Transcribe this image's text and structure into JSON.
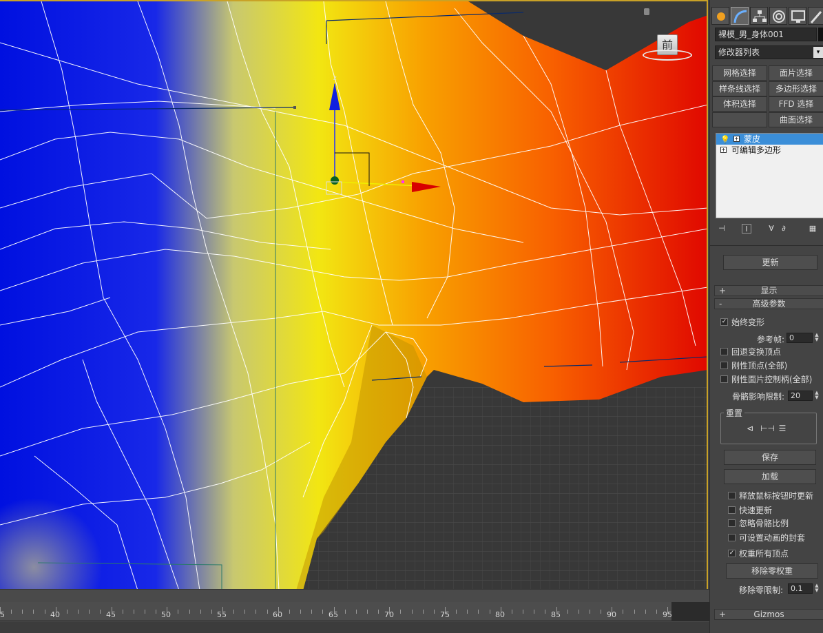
{
  "viewport": {
    "view_label": "前",
    "ruler_ticks": [
      "5",
      "40",
      "45",
      "50",
      "55",
      "60",
      "65",
      "70",
      "75",
      "80",
      "85",
      "90",
      "95"
    ]
  },
  "panel": {
    "object_name": "裸模_男_身体001",
    "modifier_list": "修改器列表",
    "preset_buttons": [
      "网格选择",
      "面片选择",
      "样条线选择",
      "多边形选择",
      "体积选择",
      "FFD 选择",
      "",
      "曲面选择"
    ],
    "stack": [
      {
        "label": "蒙皮",
        "selected": true
      },
      {
        "label": "可编辑多边形",
        "selected": false
      }
    ],
    "update_button": "更新",
    "rollout_display": "显示",
    "rollout_advanced": "高级参数",
    "always_deform": "始终变形",
    "ref_frame_label": "参考帧:",
    "ref_frame_value": "0",
    "checkboxes_a": [
      {
        "label": "回退变换顶点",
        "checked": false
      },
      {
        "label": "刚性顶点(全部)",
        "checked": false
      },
      {
        "label": "刚性面片控制柄(全部)",
        "checked": false
      }
    ],
    "bone_limit_label": "骨骼影响限制:",
    "bone_limit_value": "20",
    "reset_group": "重置",
    "save_button": "保存",
    "load_button": "加载",
    "checkboxes_b": [
      {
        "label": "释放鼠标按钮时更新",
        "checked": false
      },
      {
        "label": "快速更新",
        "checked": false
      },
      {
        "label": "忽略骨骼比例",
        "checked": false
      },
      {
        "label": "可设置动画的封套",
        "checked": false
      },
      {
        "label": "权重所有顶点",
        "checked": true
      }
    ],
    "remove_zero_weights": "移除零权重",
    "remove_zero_limit_label": "移除零限制:",
    "remove_zero_limit_value": "0.1",
    "rollout_gizmos": "Gizmos"
  },
  "colors": {
    "accent_border": "#c9a227",
    "selection_blue": "#3b8ed8",
    "weight_low": "#0010e0",
    "weight_mid": "#f0e010",
    "weight_high": "#e81000"
  },
  "icons": [
    "create-tab-icon",
    "modify-tab-icon",
    "hierarchy-tab-icon",
    "motion-tab-icon",
    "display-tab-icon",
    "utilities-tab-icon",
    "lightbulb-icon",
    "pin-stack-icon",
    "show-end-result-icon",
    "make-unique-icon",
    "remove-modifier-icon",
    "configure-sets-icon"
  ]
}
